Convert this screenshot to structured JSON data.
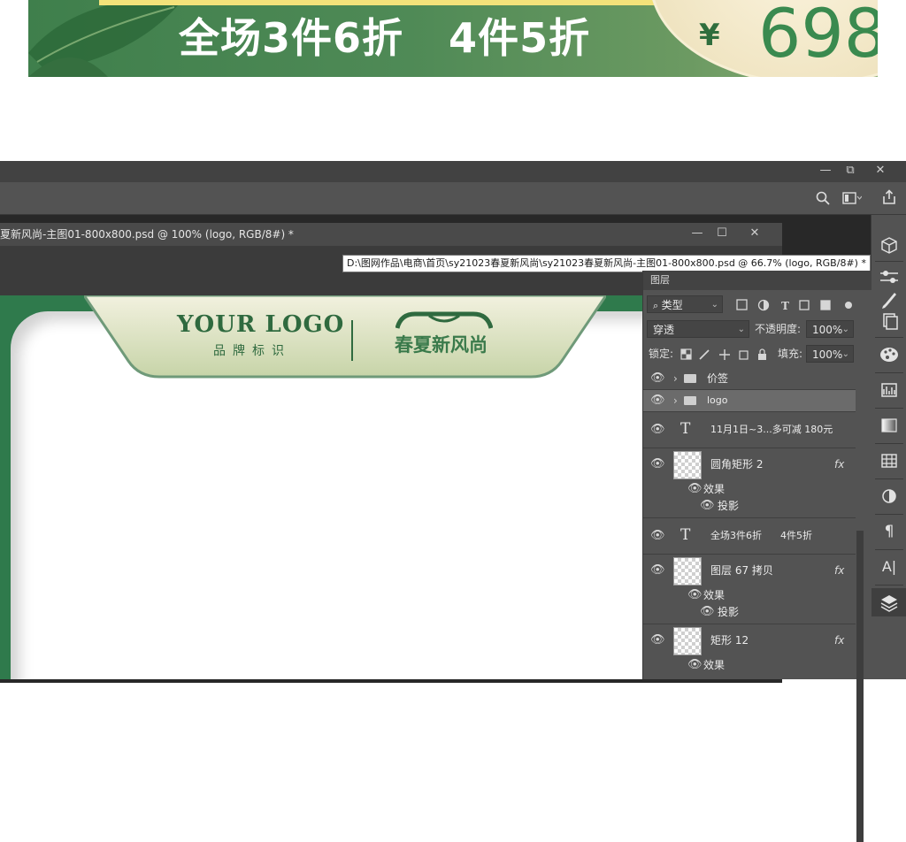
{
  "banner": {
    "slogan": "全场3件6折   4件5折",
    "price_currency": "¥",
    "price_value": "698",
    "colors": {
      "green": "#3f7f4c",
      "gold": "#efe3bf",
      "price": "#3a8a4f"
    }
  },
  "window": {
    "minimize": "—",
    "restore": "⧉",
    "close": "✕"
  },
  "toolbar": {
    "search_icon": "search-icon",
    "workspace_icon": "workspace-icon",
    "share_icon": "share-icon"
  },
  "document": {
    "title": "夏新风尚-主图01-800x800.psd @ 100% (logo, RGB/8#) *",
    "minimize": "—",
    "maximize": "☐",
    "close": "✕"
  },
  "tooltip": "D:\\图网作品\\电商\\首页\\sy21023春夏新风尚\\sy21023春夏新风尚-主图01-800x800.psd @ 66.7% (logo, RGB/8#) *",
  "canvas": {
    "your_logo": "YOUR LOGO",
    "brand_mark": "品牌标识",
    "spring_logo": "春夏新风尚",
    "colors": {
      "frame": "#2f7a4c",
      "tab": "#d9e2c2"
    }
  },
  "layers_panel": {
    "tab_label": "图层",
    "filter_label": "类型",
    "blend_mode": "穿透",
    "opacity_label": "不透明度:",
    "opacity_value": "100%",
    "lock_label": "锁定:",
    "fill_label": "填充:",
    "fill_value": "100%",
    "layers": [
      {
        "name": "价签",
        "type": "group",
        "selected": false
      },
      {
        "name": "logo",
        "type": "group",
        "selected": true
      },
      {
        "name": "11月1日~3...多可减 180元",
        "type": "text"
      },
      {
        "name": "圆角矩形 2",
        "type": "shape",
        "fx": "fx",
        "effects_label": "效果",
        "effect": "投影"
      },
      {
        "name": "全场3件6折      4件5折",
        "type": "text"
      },
      {
        "name": "图层 67 拷贝",
        "type": "pixel",
        "fx": "fx",
        "effects_label": "效果",
        "effect": "投影"
      },
      {
        "name": "矩形 12",
        "type": "shape",
        "fx": "fx",
        "effects_label": "效果"
      }
    ]
  },
  "right_tools": [
    "cube-icon",
    "adjust-icon",
    "brush-icon",
    "copy-icon",
    "palette-icon",
    "histogram-icon",
    "gradient-icon",
    "table-icon",
    "circle-half-icon",
    "paragraph-icon",
    "character-icon",
    "layers-icon"
  ],
  "right_tools_glyphs": {
    "paragraph": "¶",
    "character": "A|"
  }
}
